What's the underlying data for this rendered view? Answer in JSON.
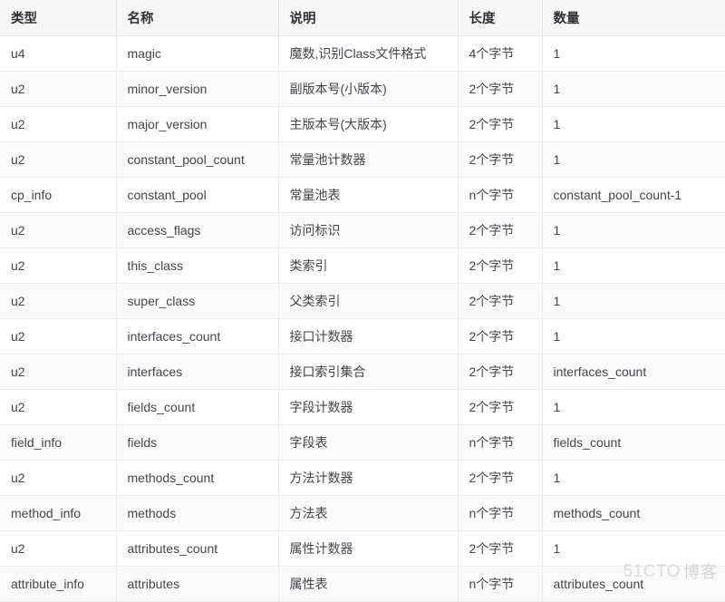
{
  "table": {
    "columns": [
      {
        "key": "type",
        "label": "类型"
      },
      {
        "key": "name",
        "label": "名称"
      },
      {
        "key": "desc",
        "label": "说明"
      },
      {
        "key": "length",
        "label": "长度"
      },
      {
        "key": "count",
        "label": "数量"
      }
    ],
    "rows": [
      {
        "type": "u4",
        "name": "magic",
        "desc": "魔数,识别Class文件格式",
        "length": "4个字节",
        "count": "1"
      },
      {
        "type": "u2",
        "name": "minor_version",
        "desc": "副版本号(小版本)",
        "length": "2个字节",
        "count": "1"
      },
      {
        "type": "u2",
        "name": "major_version",
        "desc": "主版本号(大版本)",
        "length": "2个字节",
        "count": "1"
      },
      {
        "type": "u2",
        "name": "constant_pool_count",
        "desc": "常量池计数器",
        "length": "2个字节",
        "count": "1"
      },
      {
        "type": "cp_info",
        "name": "constant_pool",
        "desc": "常量池表",
        "length": "n个字节",
        "count": "constant_pool_count-1"
      },
      {
        "type": "u2",
        "name": "access_flags",
        "desc": "访问标识",
        "length": "2个字节",
        "count": "1"
      },
      {
        "type": "u2",
        "name": "this_class",
        "desc": "类索引",
        "length": "2个字节",
        "count": "1"
      },
      {
        "type": "u2",
        "name": "super_class",
        "desc": "父类索引",
        "length": "2个字节",
        "count": "1"
      },
      {
        "type": "u2",
        "name": "interfaces_count",
        "desc": "接口计数器",
        "length": "2个字节",
        "count": "1"
      },
      {
        "type": "u2",
        "name": "interfaces",
        "desc": "接口索引集合",
        "length": "2个字节",
        "count": "interfaces_count"
      },
      {
        "type": "u2",
        "name": "fields_count",
        "desc": "字段计数器",
        "length": "2个字节",
        "count": "1"
      },
      {
        "type": "field_info",
        "name": "fields",
        "desc": "字段表",
        "length": "n个字节",
        "count": "fields_count"
      },
      {
        "type": "u2",
        "name": "methods_count",
        "desc": "方法计数器",
        "length": "2个字节",
        "count": "1"
      },
      {
        "type": "method_info",
        "name": "methods",
        "desc": "方法表",
        "length": "n个字节",
        "count": "methods_count"
      },
      {
        "type": "u2",
        "name": "attributes_count",
        "desc": "属性计数器",
        "length": "2个字节",
        "count": "1"
      },
      {
        "type": "attribute_info",
        "name": "attributes",
        "desc": "属性表",
        "length": "n个字节",
        "count": "attributes_count"
      }
    ]
  },
  "watermark": {
    "mark": "51CTO",
    "cn": "博客"
  },
  "colors": {
    "header_bg": "#f7f7f8",
    "row_alt_bg": "#fafafa",
    "row_bg": "#ffffff",
    "border": "#e3e4e6",
    "text": "#44454a",
    "header_text": "#2f2f33",
    "watermark_text": "#d9dade"
  }
}
